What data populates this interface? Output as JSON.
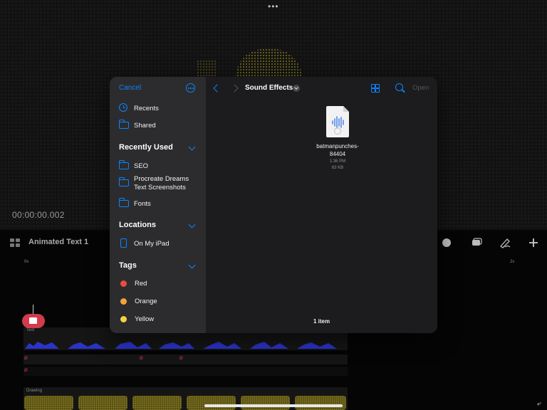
{
  "background_app": {
    "timecode": "00:00:00.002",
    "timeline_title": "Animated Text 1",
    "ruler_start": "0s",
    "ruler_end": "2s",
    "track_text_label": "Text",
    "track_drawing_label": "Drawing",
    "marker_label": "Ø"
  },
  "picker": {
    "cancel_label": "Cancel",
    "sidebar": {
      "favorites": [
        {
          "label": "Recents",
          "icon": "clock-icon"
        },
        {
          "label": "Shared",
          "icon": "shared-folder-icon"
        }
      ],
      "recently_used_header": "Recently Used",
      "recently_used": [
        {
          "label": "SEO"
        },
        {
          "label": "Procreate Dreams Text Screenshots"
        },
        {
          "label": "Fonts"
        }
      ],
      "locations_header": "Locations",
      "locations": [
        {
          "label": "On My iPad",
          "icon": "ipad-icon"
        }
      ],
      "tags_header": "Tags",
      "tags": [
        {
          "label": "Red",
          "color": "#eb4d3d"
        },
        {
          "label": "Orange",
          "color": "#f2a33a"
        },
        {
          "label": "Yellow",
          "color": "#f5d142"
        }
      ]
    },
    "main": {
      "folder_title": "Sound Effects",
      "open_label": "Open",
      "files": [
        {
          "name": "batmanpunches-84404",
          "time": "1:36 PM",
          "size": "63 KB",
          "icon": "audio-file-icon"
        }
      ],
      "item_count": "1 item"
    }
  },
  "colors": {
    "accent": "#0a84ff",
    "sidebar_bg": "#2c2c2e",
    "main_bg": "#1c1c1e"
  }
}
